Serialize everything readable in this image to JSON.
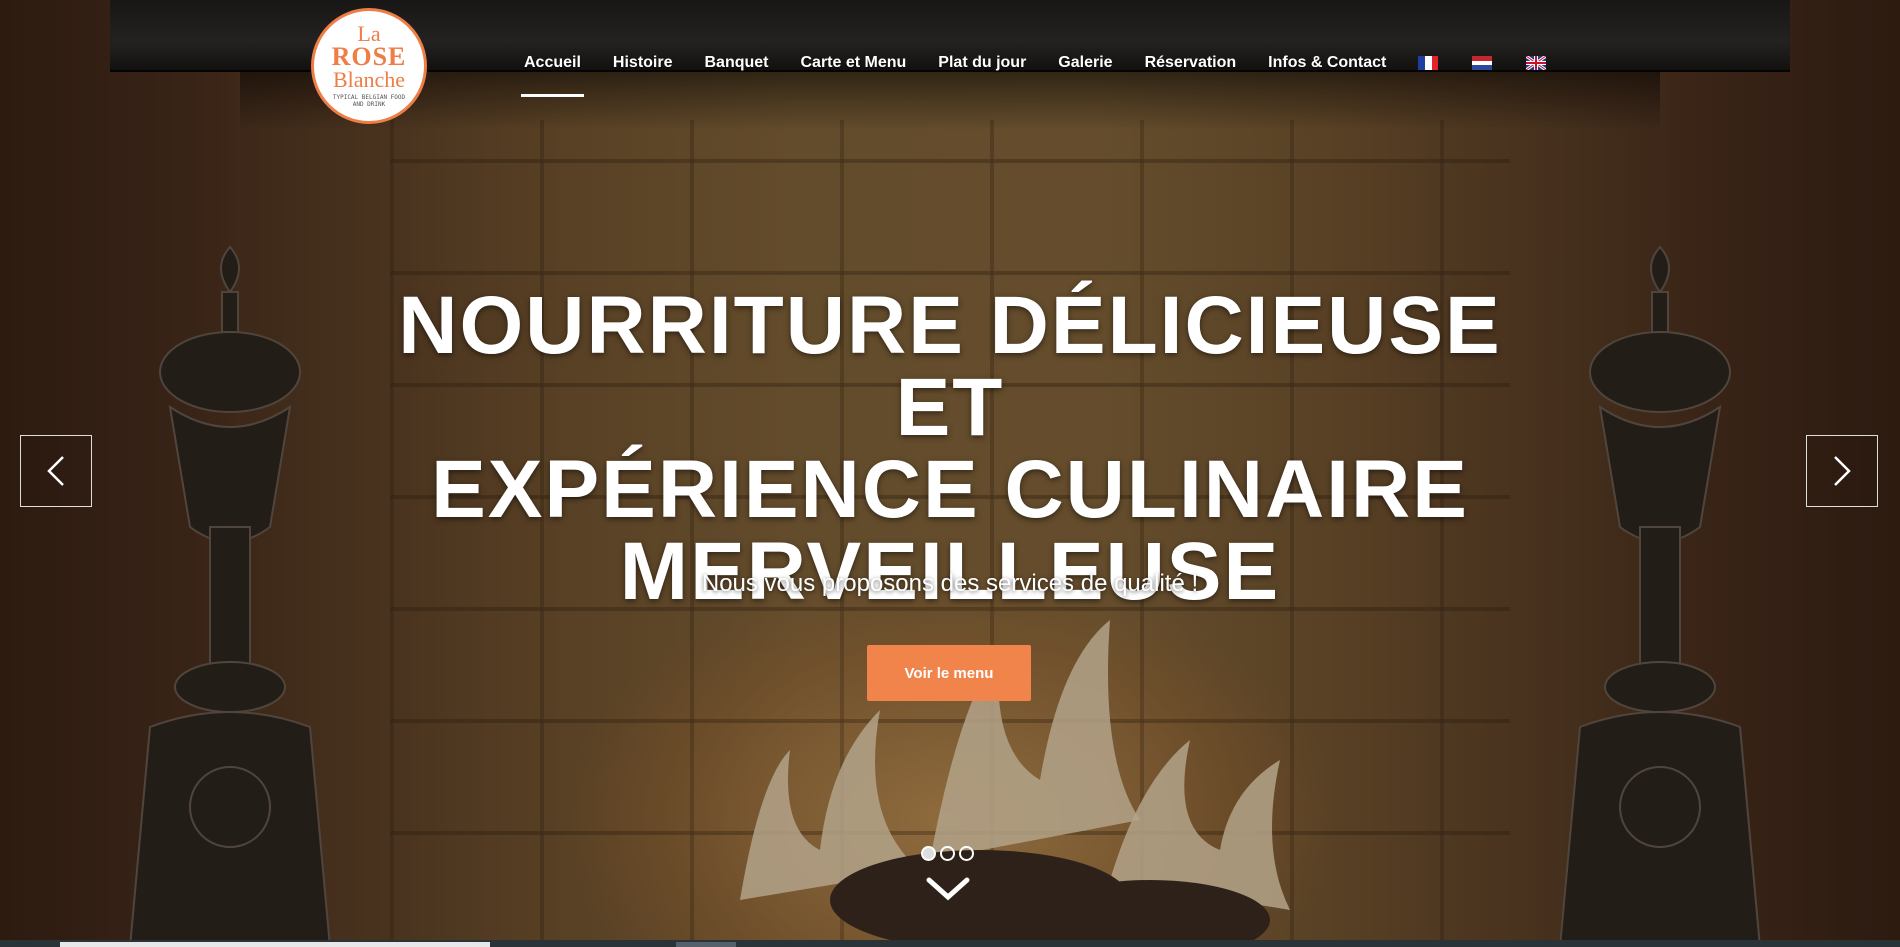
{
  "logo": {
    "line1": "La",
    "line2": "ROSE",
    "line3": "Blanche",
    "tagline": "TYPICAL BELGIAN FOOD AND DRINK"
  },
  "nav": {
    "items": [
      "Accueil",
      "Histoire",
      "Banquet",
      "Carte et Menu",
      "Plat du jour",
      "Galerie",
      "Réservation",
      "Infos & Contact"
    ],
    "active": "Accueil"
  },
  "languages": [
    {
      "icon": "flag-fr-icon",
      "code": "fr"
    },
    {
      "icon": "flag-nl-icon",
      "code": "nl"
    },
    {
      "icon": "flag-gb-icon",
      "code": "en"
    }
  ],
  "hero": {
    "headline_line1": "NOURRITURE DÉLICIEUSE ET",
    "headline_line2": "EXPÉRIENCE CULINAIRE",
    "headline_line3": "MERVEILLEUSE",
    "subline": "Nous vous proposons des services de qualité !",
    "cta_label": "Voir le menu"
  },
  "slider": {
    "slide_count": 3,
    "active_index": 0,
    "prev_icon": "chevron-left-icon",
    "next_icon": "chevron-right-icon",
    "scroll_icon": "chevron-down-icon"
  },
  "colors": {
    "accent": "#f0844a",
    "logo": "#ee7d46",
    "text": "#ffffff"
  }
}
